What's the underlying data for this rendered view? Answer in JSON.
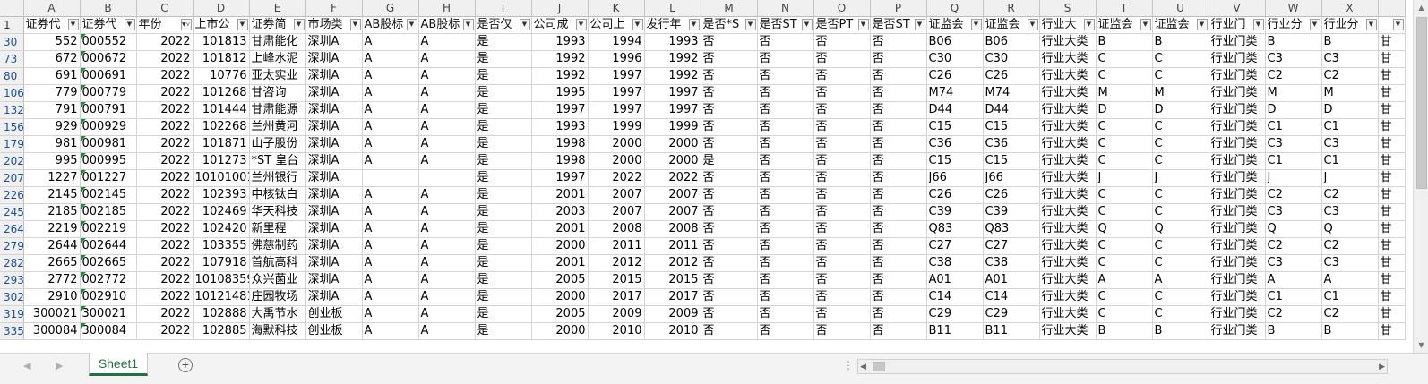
{
  "columns": [
    "A",
    "B",
    "C",
    "D",
    "E",
    "F",
    "G",
    "H",
    "I",
    "J",
    "K",
    "L",
    "M",
    "N",
    "O",
    "P",
    "Q",
    "R",
    "S",
    "T",
    "U",
    "V",
    "W",
    "X"
  ],
  "header_row_number": "1",
  "headers": [
    "证券代",
    "证券代",
    "年份",
    "上市公",
    "证券简",
    "市场类",
    "AB股标",
    "AB股标",
    "是否仅",
    "公司成",
    "公司上",
    "发行年",
    "是否*S",
    "是否ST",
    "是否PT",
    "是否ST",
    "证监会",
    "证监会",
    "行业大",
    "证监会",
    "证监会",
    "行业门",
    "行业分",
    "行业分"
  ],
  "filter_active_column": "C",
  "rows": [
    {
      "rownum": "30",
      "cells": [
        "552",
        "000552",
        "2022",
        "101813",
        "甘肃能化",
        "深圳A",
        "A",
        "A",
        "是",
        "1993",
        "1994",
        "1993",
        "否",
        "否",
        "否",
        "否",
        "B06",
        "B06",
        "行业大类",
        "B",
        "B",
        "行业门类",
        "B",
        "B"
      ]
    },
    {
      "rownum": "73",
      "cells": [
        "672",
        "000672",
        "2022",
        "101812",
        "上峰水泥",
        "深圳A",
        "A",
        "A",
        "是",
        "1992",
        "1996",
        "1992",
        "否",
        "否",
        "否",
        "否",
        "C30",
        "C30",
        "行业大类",
        "C",
        "C",
        "行业门类",
        "C3",
        "C3"
      ]
    },
    {
      "rownum": "80",
      "cells": [
        "691",
        "000691",
        "2022",
        "10776",
        "亚太实业",
        "深圳A",
        "A",
        "A",
        "是",
        "1992",
        "1997",
        "1992",
        "否",
        "否",
        "否",
        "否",
        "C26",
        "C26",
        "行业大类",
        "C",
        "C",
        "行业门类",
        "C2",
        "C2"
      ]
    },
    {
      "rownum": "106",
      "cells": [
        "779",
        "000779",
        "2022",
        "101268",
        "甘咨询",
        "深圳A",
        "A",
        "A",
        "是",
        "1995",
        "1997",
        "1997",
        "否",
        "否",
        "否",
        "否",
        "M74",
        "M74",
        "行业大类",
        "M",
        "M",
        "行业门类",
        "M",
        "M"
      ]
    },
    {
      "rownum": "132",
      "cells": [
        "791",
        "000791",
        "2022",
        "101444",
        "甘肃能源",
        "深圳A",
        "A",
        "A",
        "是",
        "1997",
        "1997",
        "1997",
        "否",
        "否",
        "否",
        "否",
        "D44",
        "D44",
        "行业大类",
        "D",
        "D",
        "行业门类",
        "D",
        "D"
      ]
    },
    {
      "rownum": "156",
      "cells": [
        "929",
        "000929",
        "2022",
        "102268",
        "兰州黄河",
        "深圳A",
        "A",
        "A",
        "是",
        "1993",
        "1999",
        "1999",
        "否",
        "否",
        "否",
        "否",
        "C15",
        "C15",
        "行业大类",
        "C",
        "C",
        "行业门类",
        "C1",
        "C1"
      ]
    },
    {
      "rownum": "179",
      "cells": [
        "981",
        "000981",
        "2022",
        "101871",
        "山子股份",
        "深圳A",
        "A",
        "A",
        "是",
        "1998",
        "2000",
        "2000",
        "否",
        "否",
        "否",
        "否",
        "C36",
        "C36",
        "行业大类",
        "C",
        "C",
        "行业门类",
        "C3",
        "C3"
      ]
    },
    {
      "rownum": "202",
      "cells": [
        "995",
        "000995",
        "2022",
        "101273",
        "*ST 皇台",
        "深圳A",
        "A",
        "A",
        "是",
        "1998",
        "2000",
        "2000",
        "是",
        "否",
        "否",
        "否",
        "C15",
        "C15",
        "行业大类",
        "C",
        "C",
        "行业门类",
        "C1",
        "C1"
      ]
    },
    {
      "rownum": "207",
      "cells": [
        "1227",
        "001227",
        "2022",
        "10101001",
        "兰州银行",
        "深圳A",
        "",
        "",
        "是",
        "1997",
        "2022",
        "2022",
        "否",
        "否",
        "否",
        "否",
        "J66",
        "J66",
        "行业大类",
        "J",
        "J",
        "行业门类",
        "J",
        "J"
      ]
    },
    {
      "rownum": "226",
      "cells": [
        "2145",
        "002145",
        "2022",
        "102393",
        "中核钛白",
        "深圳A",
        "A",
        "A",
        "是",
        "2001",
        "2007",
        "2007",
        "否",
        "否",
        "否",
        "否",
        "C26",
        "C26",
        "行业大类",
        "C",
        "C",
        "行业门类",
        "C2",
        "C2"
      ]
    },
    {
      "rownum": "245",
      "cells": [
        "2185",
        "002185",
        "2022",
        "102469",
        "华天科技",
        "深圳A",
        "A",
        "A",
        "是",
        "2003",
        "2007",
        "2007",
        "否",
        "否",
        "否",
        "否",
        "C39",
        "C39",
        "行业大类",
        "C",
        "C",
        "行业门类",
        "C3",
        "C3"
      ]
    },
    {
      "rownum": "264",
      "cells": [
        "2219",
        "002219",
        "2022",
        "102420",
        "新里程",
        "深圳A",
        "A",
        "A",
        "是",
        "2001",
        "2008",
        "2008",
        "否",
        "否",
        "否",
        "否",
        "Q83",
        "Q83",
        "行业大类",
        "Q",
        "Q",
        "行业门类",
        "Q",
        "Q"
      ]
    },
    {
      "rownum": "279",
      "cells": [
        "2644",
        "002644",
        "2022",
        "103355",
        "佛慈制药",
        "深圳A",
        "A",
        "A",
        "是",
        "2000",
        "2011",
        "2011",
        "否",
        "否",
        "否",
        "否",
        "C27",
        "C27",
        "行业大类",
        "C",
        "C",
        "行业门类",
        "C2",
        "C2"
      ]
    },
    {
      "rownum": "282",
      "cells": [
        "2665",
        "002665",
        "2022",
        "107918",
        "首航高科",
        "深圳A",
        "A",
        "A",
        "是",
        "2001",
        "2012",
        "2012",
        "否",
        "否",
        "否",
        "否",
        "C38",
        "C38",
        "行业大类",
        "C",
        "C",
        "行业门类",
        "C3",
        "C3"
      ]
    },
    {
      "rownum": "293",
      "cells": [
        "2772",
        "002772",
        "2022",
        "10108359",
        "众兴菌业",
        "深圳A",
        "A",
        "A",
        "是",
        "2005",
        "2015",
        "2015",
        "否",
        "否",
        "否",
        "否",
        "A01",
        "A01",
        "行业大类",
        "A",
        "A",
        "行业门类",
        "A",
        "A"
      ]
    },
    {
      "rownum": "302",
      "cells": [
        "2910",
        "002910",
        "2022",
        "10121481",
        "庄园牧场",
        "深圳A",
        "A",
        "A",
        "是",
        "2000",
        "2017",
        "2017",
        "否",
        "否",
        "否",
        "否",
        "C14",
        "C14",
        "行业大类",
        "C",
        "C",
        "行业门类",
        "C1",
        "C1"
      ]
    },
    {
      "rownum": "319",
      "cells": [
        "300021",
        "300021",
        "2022",
        "102888",
        "大禹节水",
        "创业板",
        "A",
        "A",
        "是",
        "2005",
        "2009",
        "2009",
        "否",
        "否",
        "否",
        "否",
        "C29",
        "C29",
        "行业大类",
        "C",
        "C",
        "行业门类",
        "C2",
        "C2"
      ]
    },
    {
      "rownum": "335",
      "cells": [
        "300084",
        "300084",
        "2022",
        "102885",
        "海默科技",
        "创业板",
        "A",
        "A",
        "是",
        "2000",
        "2010",
        "2010",
        "否",
        "否",
        "否",
        "否",
        "B11",
        "B11",
        "行业大类",
        "B",
        "B",
        "行业门类",
        "B",
        "B"
      ]
    }
  ],
  "overflow_text": "甘",
  "sheet_tab": "Sheet1",
  "add_sheet_symbol": "⊕",
  "colors": {
    "accent": "#217346",
    "rownum_text": "#1a4fa0",
    "gridline": "#d4d4d4",
    "header_bg": "#f0f0f0"
  }
}
